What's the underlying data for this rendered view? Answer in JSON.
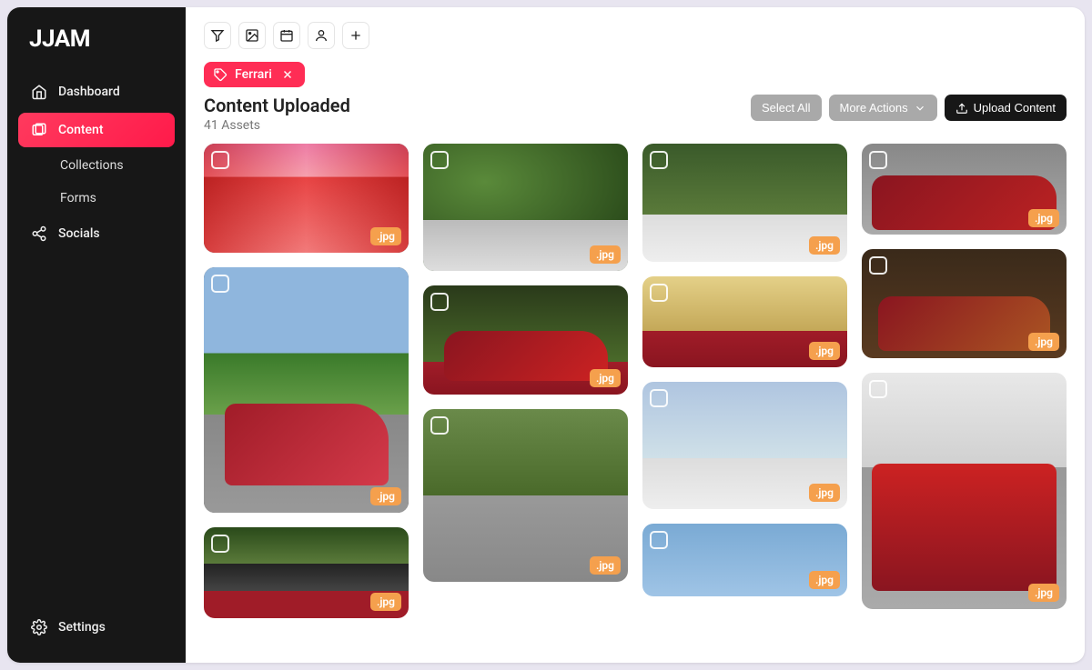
{
  "brand": "JJAM",
  "sidebar": {
    "items": [
      {
        "label": "Dashboard"
      },
      {
        "label": "Content"
      },
      {
        "label": "Collections"
      },
      {
        "label": "Forms"
      },
      {
        "label": "Socials"
      }
    ],
    "footer": {
      "label": "Settings"
    }
  },
  "filters": {
    "chips": [
      {
        "label": "Ferrari"
      }
    ]
  },
  "header": {
    "title": "Content Uploaded",
    "count": "41 Assets"
  },
  "actions": {
    "select_all": "Select All",
    "more": "More Actions",
    "upload": "Upload Content"
  },
  "badge_label": ".jpg",
  "assets": [
    {
      "ext": ".jpg"
    },
    {
      "ext": ".jpg"
    },
    {
      "ext": ".jpg"
    },
    {
      "ext": ".jpg"
    },
    {
      "ext": ".jpg"
    },
    {
      "ext": ".jpg"
    },
    {
      "ext": ".jpg"
    },
    {
      "ext": ".jpg"
    },
    {
      "ext": ".jpg"
    },
    {
      "ext": ".jpg"
    },
    {
      "ext": ".jpg"
    },
    {
      "ext": ".jpg"
    },
    {
      "ext": ".jpg"
    }
  ]
}
